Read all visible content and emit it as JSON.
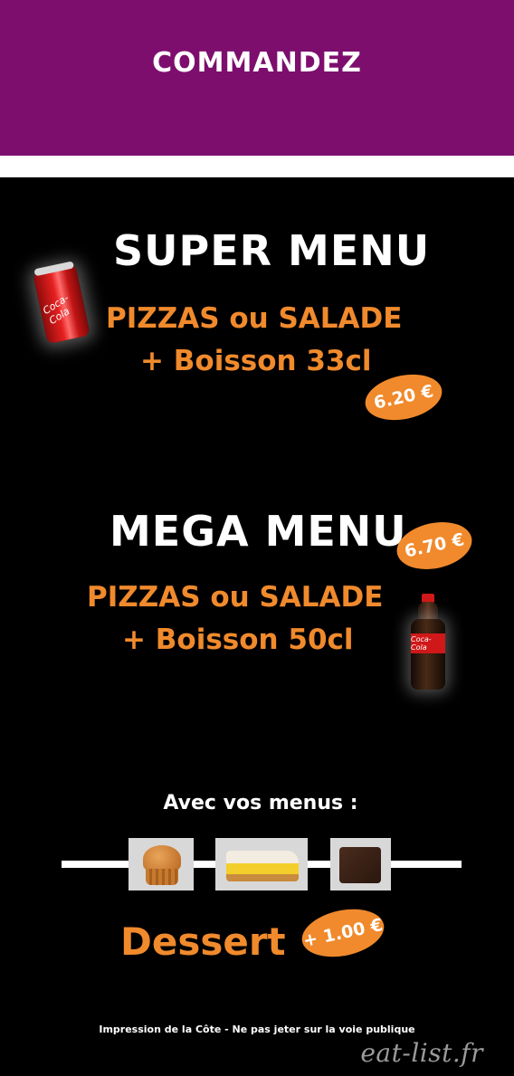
{
  "header": {
    "title": "COMMANDEZ",
    "color": "#7d0e6e"
  },
  "super_menu": {
    "title": "SUPER MENU",
    "line1": "PIZZAS ou SALADE",
    "line2": "+ Boisson 33cl",
    "price": "6.20 €",
    "drink_label": "Coca-Cola"
  },
  "mega_menu": {
    "title": "MEGA MENU",
    "line1": "PIZZAS ou SALADE",
    "line2": "+ Boisson 50cl",
    "price": "6.70 €",
    "drink_label": "Coca-Cola"
  },
  "desserts": {
    "intro": "Avec vos menus :",
    "label": "Dessert",
    "price": "+ 1.00 €",
    "items": [
      "muffin",
      "tarte au citron meringuée",
      "brownie"
    ]
  },
  "footer": {
    "note": "Impression de la Côte - Ne pas jeter sur la voie publique",
    "watermark": "eat-list.fr"
  },
  "colors": {
    "accent": "#f08a2c",
    "background": "#000000",
    "header": "#7d0e6e"
  }
}
